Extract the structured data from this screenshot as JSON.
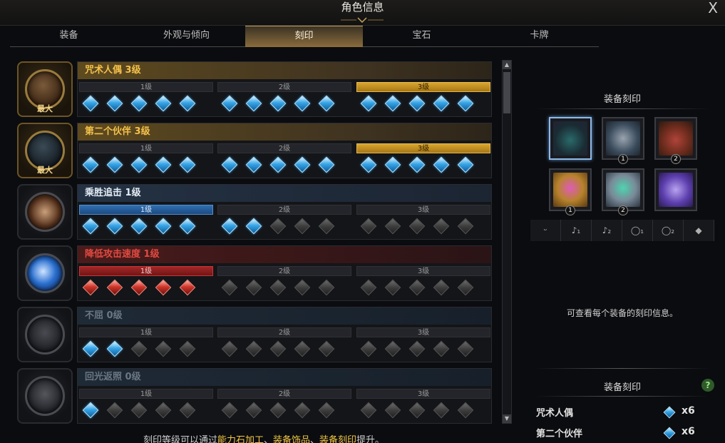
{
  "window": {
    "title": "角色信息",
    "close_label": "X"
  },
  "tabs": [
    {
      "label": "装备",
      "active": false
    },
    {
      "label": "外观与倾向",
      "active": false
    },
    {
      "label": "刻印",
      "active": true
    },
    {
      "label": "宝石",
      "active": false
    },
    {
      "label": "卡牌",
      "active": false
    }
  ],
  "engravings": [
    {
      "name": "咒术人偶 3级",
      "style": "gold",
      "max_label": "最大",
      "levels": [
        "1级",
        "2级",
        "3级"
      ],
      "active_level": 3,
      "gem_state": [
        "blue",
        "blue",
        "blue",
        "blue",
        "blue",
        "blue",
        "blue",
        "blue",
        "blue",
        "blue",
        "blue",
        "blue",
        "blue",
        "blue",
        "blue"
      ]
    },
    {
      "name": "第二个伙伴 3级",
      "style": "gold",
      "max_label": "最大",
      "levels": [
        "1级",
        "2级",
        "3级"
      ],
      "active_level": 3,
      "gem_state": [
        "blue",
        "blue",
        "blue",
        "blue",
        "blue",
        "blue",
        "blue",
        "blue",
        "blue",
        "blue",
        "blue",
        "blue",
        "blue",
        "blue",
        "blue"
      ]
    },
    {
      "name": "乘胜追击 1级",
      "style": "blue",
      "max_label": "",
      "levels": [
        "1级",
        "2级",
        "3级"
      ],
      "active_level": 1,
      "gem_state": [
        "blue",
        "blue",
        "blue",
        "blue",
        "blue",
        "blue",
        "blue",
        "off",
        "off",
        "off",
        "off",
        "off",
        "off",
        "off",
        "off"
      ]
    },
    {
      "name": "降低攻击速度 1级",
      "style": "red",
      "max_label": "",
      "levels": [
        "1级",
        "2级",
        "3级"
      ],
      "active_level": 1,
      "gem_state": [
        "red",
        "red",
        "red",
        "red",
        "red",
        "off",
        "off",
        "off",
        "off",
        "off",
        "off",
        "off",
        "off",
        "off",
        "off"
      ]
    },
    {
      "name": "不屈 0级",
      "style": "grey",
      "max_label": "",
      "levels": [
        "1级",
        "2级",
        "3级"
      ],
      "active_level": 0,
      "gem_state": [
        "blue",
        "blue",
        "off",
        "off",
        "off",
        "off",
        "off",
        "off",
        "off",
        "off",
        "off",
        "off",
        "off",
        "off",
        "off"
      ]
    },
    {
      "name": "回光返照 0级",
      "style": "grey",
      "max_label": "",
      "levels": [
        "1级",
        "2级",
        "3级"
      ],
      "active_level": 0,
      "gem_state": [
        "blue",
        "off",
        "off",
        "off",
        "off",
        "off",
        "off",
        "off",
        "off",
        "off",
        "off",
        "off",
        "off",
        "off",
        "off"
      ]
    }
  ],
  "footer": {
    "prefix": "刻印等级可以通过",
    "link1": "能力石加工",
    "sep1": "、",
    "link2": "装备饰品",
    "sep2": "、",
    "link3": "装备刻印",
    "suffix": "提升。"
  },
  "right_panel": {
    "title": "装备刻印",
    "slots": [
      {
        "name": "necklace",
        "num": ""
      },
      {
        "name": "earring",
        "num": "1"
      },
      {
        "name": "earring",
        "num": "2"
      },
      {
        "name": "ring",
        "num": "1"
      },
      {
        "name": "ring",
        "num": "2"
      },
      {
        "name": "ability-stone",
        "num": ""
      }
    ],
    "filter_icons": [
      "necklace-icon",
      "earring-1-icon",
      "earring-2-icon",
      "ring-1-icon",
      "ring-2-icon",
      "stone-icon"
    ],
    "filter_glyphs": [
      "ᵕ",
      "♪₁",
      "♪₂",
      "◯₁",
      "◯₂",
      "◆"
    ],
    "hint": "可查看每个装备的刻印信息。",
    "summary_title": "装备刻印",
    "help_label": "?",
    "summary": [
      {
        "name": "咒术人偶",
        "count": "x6"
      },
      {
        "name": "第二个伙伴",
        "count": "x6"
      }
    ]
  },
  "colors": {
    "gold": "#f5c24a",
    "blue_gem": "#37a6e8",
    "red": "#e24a41"
  }
}
